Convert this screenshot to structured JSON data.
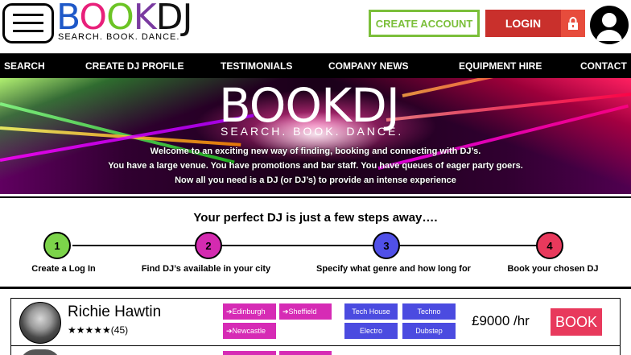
{
  "header": {
    "logo_word": "BOOKDJ",
    "logo_tagline": "SEARCH.   BOOK.   DANCE.",
    "create_account_label": "CREATE ACCOUNT",
    "login_label": "LOGIN"
  },
  "nav": {
    "items": [
      "SEARCH",
      "CREATE DJ PROFILE",
      "TESTIMONIALS",
      "COMPANY NEWS",
      "EQUIPMENT HIRE",
      "CONTACT"
    ]
  },
  "hero": {
    "logo_word": "BOOKDJ",
    "logo_tagline": "SEARCH.   BOOK.   DANCE.",
    "lines": [
      "Welcome to an exciting new way of finding, booking and connecting with DJ’s.",
      "You have a large venue. You have promotions and bar staff. You have queues of eager party goers.",
      "Now all you need is a DJ (or DJ’s) to provide an intense experience"
    ]
  },
  "steps": {
    "title": "Your perfect DJ is just a few steps away….",
    "items": [
      {
        "number": "1",
        "label": "Create a Log In",
        "color": "#7cd44a"
      },
      {
        "number": "2",
        "label": "Find DJ’s available in your city",
        "color": "#d42bb0"
      },
      {
        "number": "3",
        "label": "Specify what genre and how long for",
        "color": "#5050e8"
      },
      {
        "number": "4",
        "label": "Book your chosen DJ",
        "color": "#e8395c"
      }
    ]
  },
  "listings": [
    {
      "name": "Richie Hawtin",
      "stars": "★★★★★",
      "reviews": "(45)",
      "locations": [
        "➔Edinburgh",
        "➔Sheffield",
        "➔Newcastle"
      ],
      "genres": [
        "Tech House",
        "Techno",
        "Electro",
        "Dubstep"
      ],
      "price": "£9000 /hr",
      "book_label": "BOOK"
    }
  ],
  "colors": {
    "create_account": "#7bbf3a",
    "login": "#c9302c",
    "location_tag": "#d62bb5",
    "genre_tag": "#4b4be0",
    "book": "#e8395c"
  }
}
